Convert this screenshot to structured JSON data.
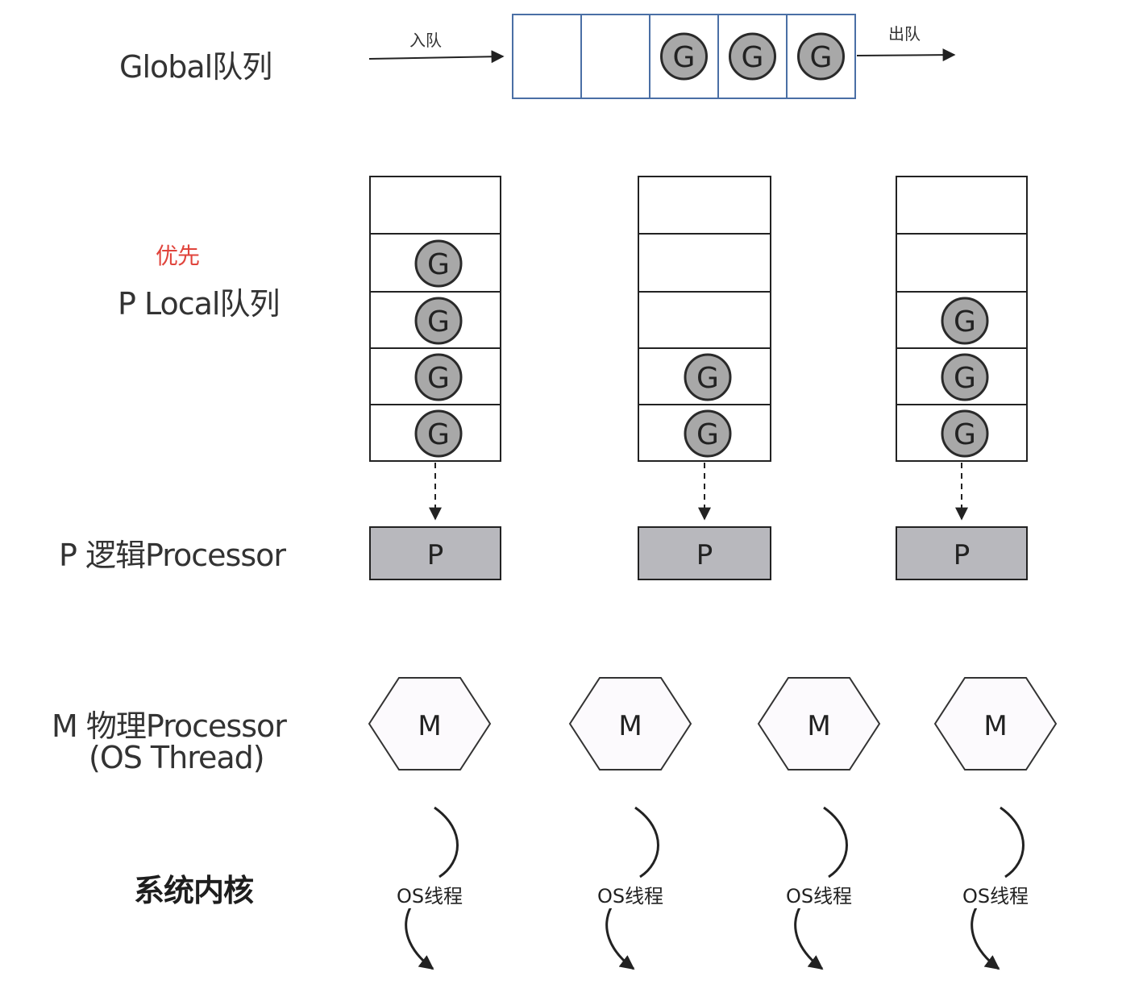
{
  "labels": {
    "global_queue": "Global队列",
    "enqueue": "入队",
    "dequeue": "出队",
    "priority": "优先",
    "local_queue": "P Local队列",
    "logical_processor": "P 逻辑Processor",
    "physical_processor_line1": "M 物理Processor",
    "physical_processor_line2": "(OS Thread)",
    "kernel": "系统内核"
  },
  "global_queue": {
    "slots": [
      "",
      "",
      "G",
      "G",
      "G"
    ]
  },
  "local_queues": [
    {
      "slots": [
        "",
        "G",
        "G",
        "G",
        "G"
      ],
      "processor": "P"
    },
    {
      "slots": [
        "",
        "",
        "",
        "G",
        "G"
      ],
      "processor": "P"
    },
    {
      "slots": [
        "",
        "",
        "G",
        "G",
        "G"
      ],
      "processor": "P"
    }
  ],
  "machines": [
    {
      "label": "M",
      "thread": "OS线程"
    },
    {
      "label": "M",
      "thread": "OS线程"
    },
    {
      "label": "M",
      "thread": "OS线程"
    },
    {
      "label": "M",
      "thread": "OS线程"
    }
  ],
  "colors": {
    "global_queue_border": "#4a6fa5",
    "box_border": "#222222",
    "goroutine_fill": "#a8a8a8",
    "processor_fill": "#b8b8bd",
    "machine_fill": "#fcfafd",
    "priority_text": "#e0443c"
  }
}
